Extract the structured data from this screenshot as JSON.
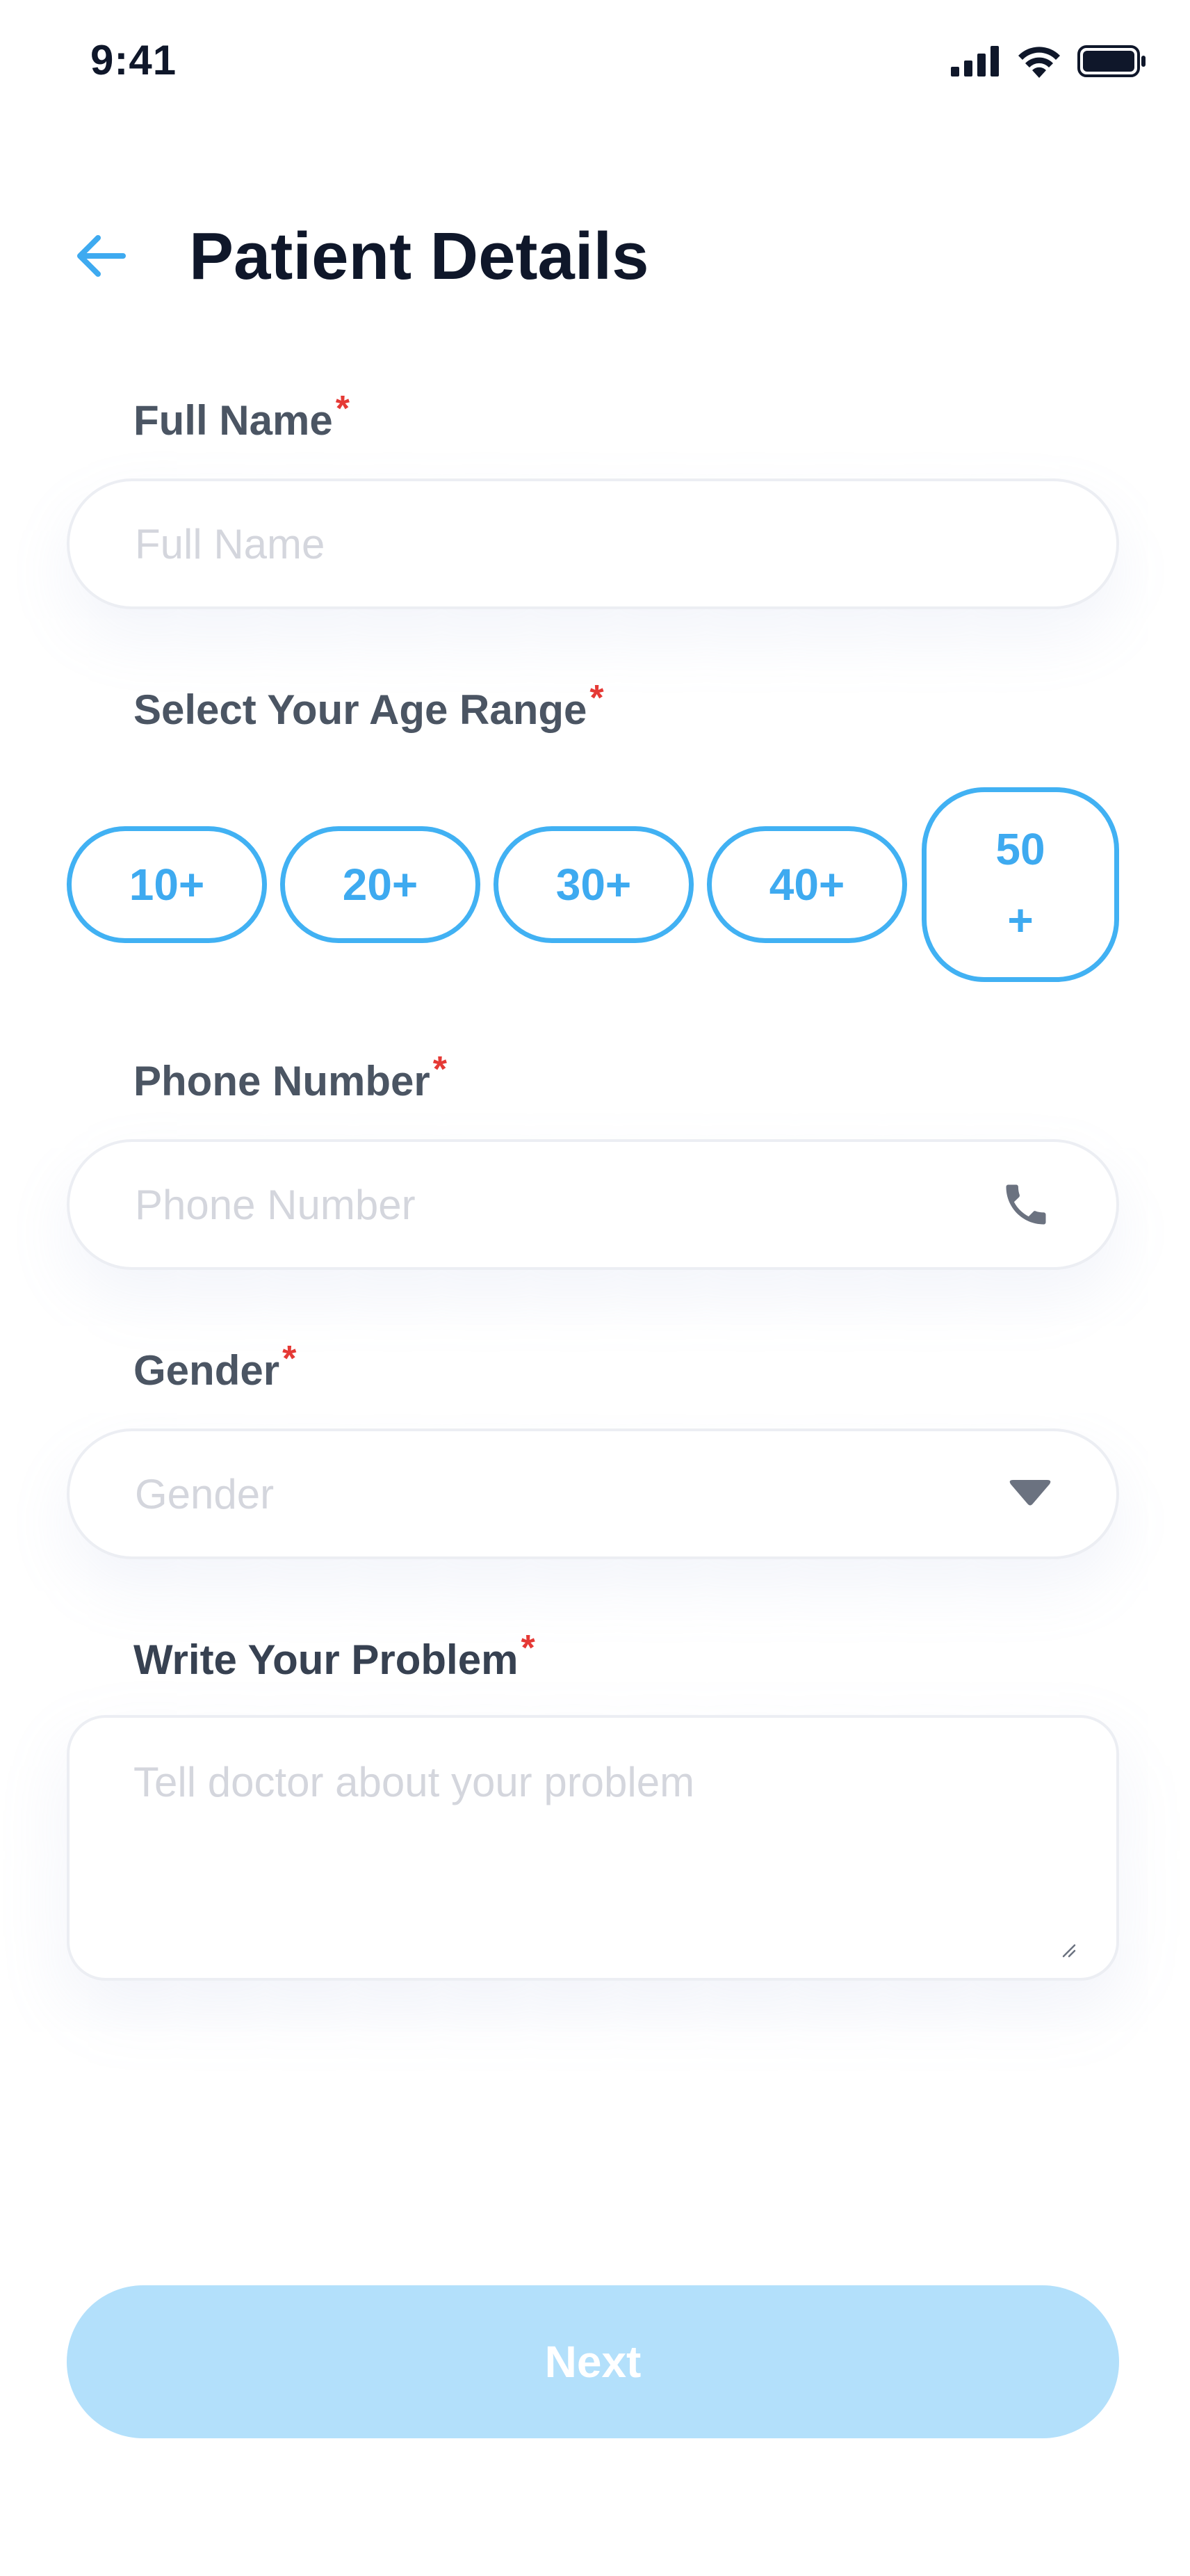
{
  "status_bar": {
    "time": "9:41"
  },
  "header": {
    "title": "Patient Details",
    "back_icon": "arrow-left-icon"
  },
  "form": {
    "required_marker": "*",
    "full_name": {
      "label": "Full Name",
      "placeholder": "Full Name"
    },
    "age_range": {
      "label": "Select Your Age Range",
      "options": [
        "10+",
        "20+",
        "30+",
        "40+"
      ],
      "last_option_top": "50",
      "last_option_bottom": "+"
    },
    "phone": {
      "label": "Phone Number",
      "placeholder": "Phone Number",
      "icon": "phone-icon"
    },
    "gender": {
      "label": "Gender",
      "placeholder": "Gender",
      "icon": "caret-down-icon"
    },
    "problem": {
      "label": "Write Your Problem",
      "placeholder": "Tell doctor about your problem"
    }
  },
  "next_button": {
    "label": "Next"
  },
  "colors": {
    "accent": "#41b1f3",
    "button_disabled": "#b3e0fb",
    "required": "#e53935",
    "label": "#4b5563",
    "title": "#0f172a",
    "placeholder": "#d4d6dd"
  }
}
